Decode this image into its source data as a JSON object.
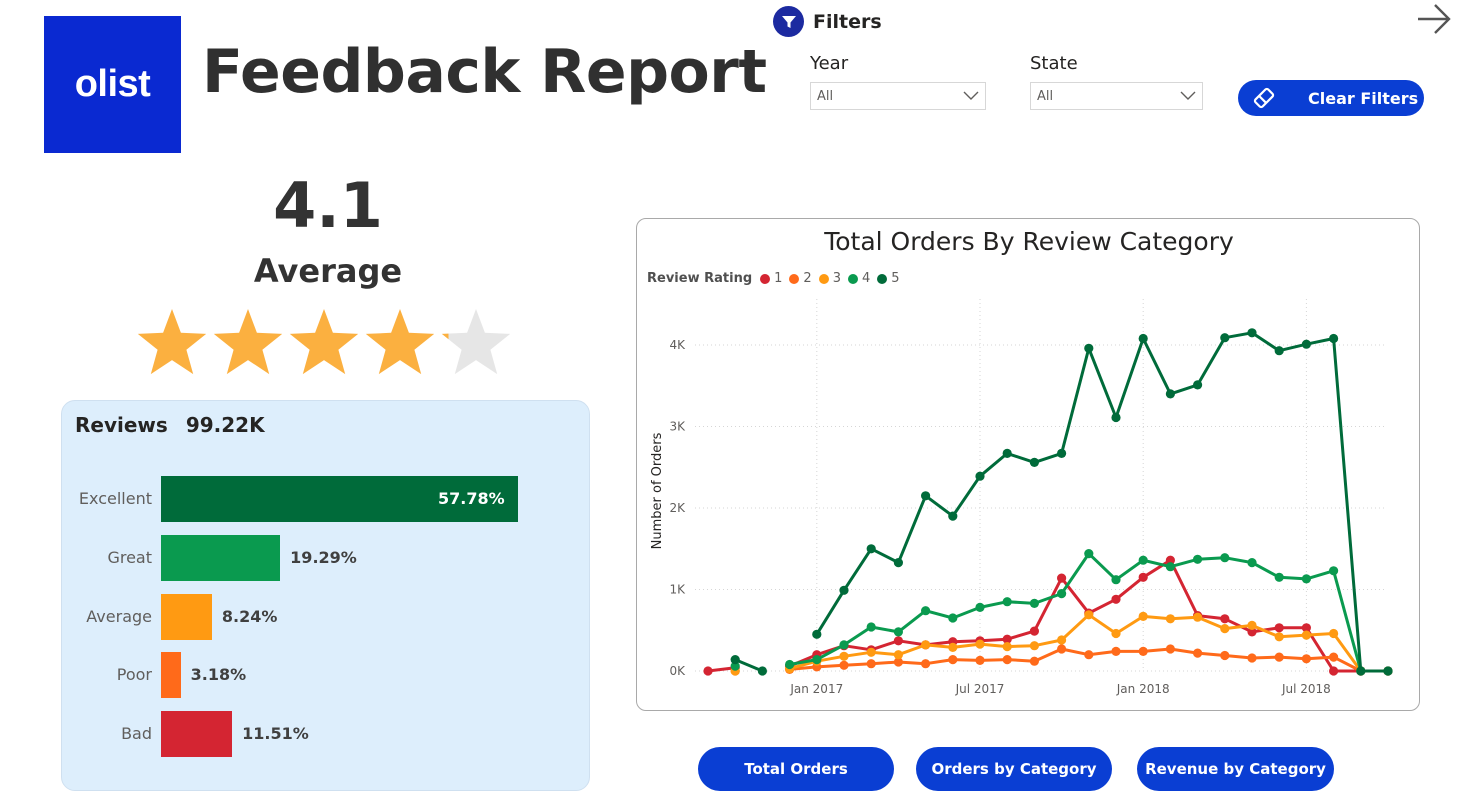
{
  "logo": {
    "text": "olist",
    "bg_color": "#0a29d1"
  },
  "header": {
    "title": "Feedback Report"
  },
  "filters": {
    "title": "Filters",
    "icon": "funnel-icon",
    "year": {
      "label": "Year",
      "value": "All"
    },
    "state": {
      "label": "State",
      "value": "All"
    },
    "clear_label": "Clear Filters",
    "clear_icon": "eraser-icon"
  },
  "nav": {
    "back_icon": "arrow-right-icon"
  },
  "rating": {
    "value": "4.1",
    "label": "Average",
    "stars": 4.1,
    "max_stars": 5
  },
  "reviews": {
    "label": "Reviews",
    "total": "99.22K",
    "rows": [
      {
        "label": "Excellent",
        "value": "57.78%",
        "pct": 57.78,
        "color": "#006b3a"
      },
      {
        "label": "Great",
        "value": "19.29%",
        "pct": 19.29,
        "color": "#0a9a4f"
      },
      {
        "label": "Average",
        "value": "8.24%",
        "pct": 8.24,
        "color": "#ff9a12"
      },
      {
        "label": "Poor",
        "value": "3.18%",
        "pct": 3.18,
        "color": "#ff6a1a"
      },
      {
        "label": "Bad",
        "value": "11.51%",
        "pct": 11.51,
        "color": "#d42532"
      }
    ]
  },
  "chart_data": {
    "type": "line",
    "title": "Total Orders By Review Category",
    "ylabel": "Number of Orders",
    "xlabel": "",
    "legend_title": "Review Rating",
    "legend_position": "top-left",
    "grid": true,
    "ylim": [
      0,
      4500
    ],
    "y_ticks": [
      {
        "value": 0,
        "label": "0K"
      },
      {
        "value": 1000,
        "label": "1K"
      },
      {
        "value": 2000,
        "label": "2K"
      },
      {
        "value": 3000,
        "label": "3K"
      },
      {
        "value": 4000,
        "label": "4K"
      }
    ],
    "x_ticks": [
      {
        "index": 4,
        "label": "Jan 2017"
      },
      {
        "index": 10,
        "label": "Jul 2017"
      },
      {
        "index": 16,
        "label": "Jan 2018"
      },
      {
        "index": 22,
        "label": "Jul 2018"
      }
    ],
    "x": [
      "2016-09",
      "2016-10",
      "2016-11",
      "2016-12",
      "2017-01",
      "2017-02",
      "2017-03",
      "2017-04",
      "2017-05",
      "2017-06",
      "2017-07",
      "2017-08",
      "2017-09",
      "2017-10",
      "2017-11",
      "2017-12",
      "2018-01",
      "2018-02",
      "2018-03",
      "2018-04",
      "2018-05",
      "2018-06",
      "2018-07",
      "2018-08",
      "2018-09",
      "2018-10"
    ],
    "series": [
      {
        "name": "1",
        "color": "#d42532",
        "values": [
          0,
          40,
          null,
          60,
          200,
          310,
          260,
          370,
          320,
          360,
          370,
          390,
          490,
          1140,
          710,
          880,
          1150,
          1360,
          680,
          640,
          480,
          530,
          530,
          0,
          0,
          0
        ]
      },
      {
        "name": "2",
        "color": "#ff6a1a",
        "values": [
          null,
          0,
          null,
          20,
          50,
          70,
          90,
          110,
          90,
          140,
          130,
          140,
          120,
          270,
          200,
          240,
          240,
          270,
          220,
          190,
          160,
          170,
          150,
          170,
          0,
          0
        ]
      },
      {
        "name": "3",
        "color": "#ff9a12",
        "values": [
          null,
          0,
          null,
          30,
          120,
          180,
          230,
          200,
          320,
          290,
          330,
          300,
          310,
          380,
          690,
          460,
          670,
          640,
          660,
          520,
          560,
          420,
          440,
          460,
          0,
          0
        ]
      },
      {
        "name": "4",
        "color": "#0a9a4f",
        "values": [
          null,
          60,
          null,
          80,
          140,
          320,
          540,
          480,
          740,
          650,
          780,
          850,
          830,
          950,
          1440,
          1120,
          1360,
          1280,
          1370,
          1390,
          1330,
          1150,
          1130,
          1230,
          0,
          0
        ]
      },
      {
        "name": "5",
        "color": "#006b3a",
        "values": [
          null,
          140,
          0,
          null,
          450,
          990,
          1500,
          1330,
          2150,
          1900,
          2390,
          2670,
          2560,
          2670,
          3960,
          3110,
          4080,
          3400,
          3510,
          4090,
          4150,
          3930,
          4010,
          4080,
          0,
          0
        ]
      }
    ]
  },
  "buttons": [
    {
      "label": "Total Orders"
    },
    {
      "label": "Orders by Category"
    },
    {
      "label": "Revenue by Category"
    }
  ]
}
